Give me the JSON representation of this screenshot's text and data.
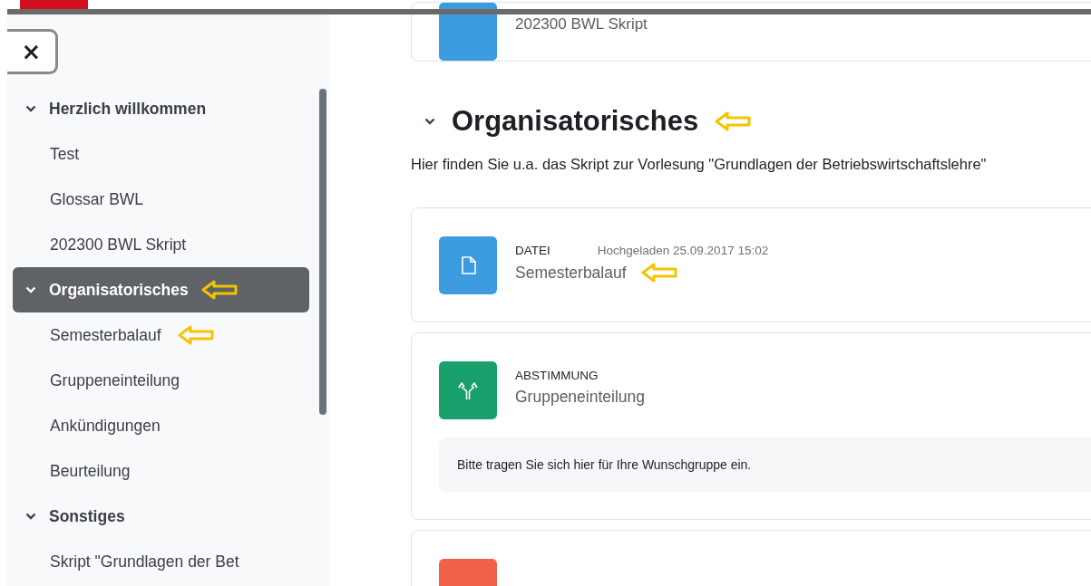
{
  "close_button": {
    "label": "×"
  },
  "sidebar": {
    "sections": [
      {
        "title": "Herzlich willkommen",
        "expanded": true,
        "selected": false,
        "arrow_marker": false,
        "children": [
          {
            "label": "Test",
            "arrow_marker": false
          },
          {
            "label": "Glossar BWL",
            "arrow_marker": false
          },
          {
            "label": "202300 BWL Skript",
            "arrow_marker": false
          }
        ]
      },
      {
        "title": "Organisatorisches",
        "expanded": true,
        "selected": true,
        "arrow_marker": true,
        "children": [
          {
            "label": "Semesterbalauf",
            "arrow_marker": true
          },
          {
            "label": "Gruppeneinteilung",
            "arrow_marker": false
          },
          {
            "label": "Ankündigungen",
            "arrow_marker": false
          },
          {
            "label": "Beurteilung",
            "arrow_marker": false
          }
        ]
      },
      {
        "title": "Sonstiges",
        "expanded": true,
        "selected": false,
        "arrow_marker": false,
        "children": [
          {
            "label": "Skript \"Grundlagen der Bet",
            "arrow_marker": false
          }
        ]
      }
    ]
  },
  "main": {
    "top_card": {
      "title": "202300 BWL Skript",
      "kind": "file"
    },
    "section": {
      "title": "Organisatorisches",
      "expanded": true,
      "arrow_marker": true,
      "description": "Hier finden Sie u.a. das Skript zur Vorlesung \"Grundlagen der Betriebswirtschaftslehre\""
    },
    "activities": [
      {
        "kind": "file",
        "type_label": "DATEI",
        "meta": "Hochgeladen 25.09.2017 15:02",
        "title": "Semesterbalauf",
        "arrow_marker": true
      },
      {
        "kind": "choice",
        "type_label": "ABSTIMMUNG",
        "title": "Gruppeneinteilung",
        "arrow_marker": false,
        "note": "Bitte tragen Sie sich hier für Ihre Wunschgruppe ein."
      },
      {
        "kind": "other"
      }
    ]
  }
}
